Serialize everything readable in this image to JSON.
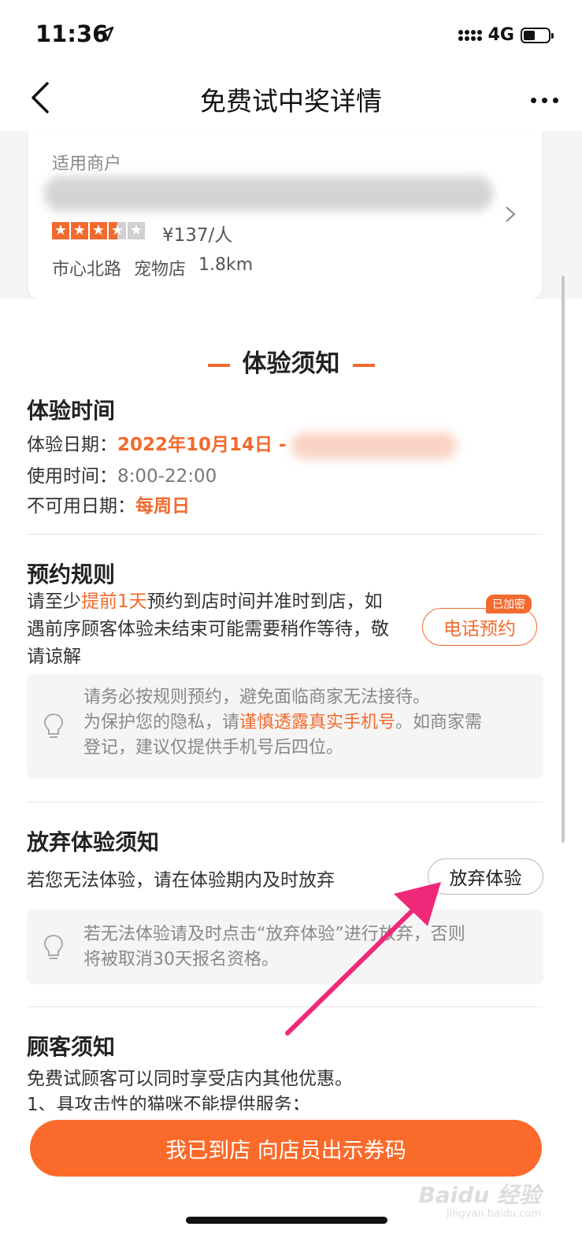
{
  "status": {
    "time": "11:36",
    "network": "4G",
    "battery_level": 0.45
  },
  "nav": {
    "title": "免费试中奖详情"
  },
  "merchant": {
    "label": "适用商户",
    "rating_stars": 3.5,
    "price": "¥137/人",
    "address": "市心北路",
    "category": "宠物店",
    "distance": "1.8km"
  },
  "notice": {
    "heading": "体验须知",
    "time_section": {
      "title": "体验时间",
      "date_label": "体验日期：",
      "date_value": "2022年10月14日 -",
      "use_time_label": "使用时间：",
      "use_time_value": "8:00-22:00",
      "unavailable_label": "不可用日期：",
      "unavailable_value": "每周日"
    },
    "booking": {
      "title": "预约规则",
      "text_prefix": "请至少",
      "text_highlight": "提前1天",
      "text_line1_rest": "预约到店时间并准时到店，如",
      "text_line2": "遇前序顾客体验未结束可能需要稍作等待，敬",
      "text_line3": "请谅解",
      "phone_button": "电话预约",
      "phone_badge": "已加密",
      "tip_line1": "请务必按规则预约，避免面临商家无法接待。",
      "tip_line2_prefix": "为保护您的隐私，请",
      "tip_line2_highlight": "谨慎透露真实手机号",
      "tip_line2_suffix": "。如商家需",
      "tip_line3": "登记，建议仅提供手机号后四位。"
    },
    "abandon": {
      "title": "放弃体验须知",
      "text": "若您无法体验，请在体验期内及时放弃",
      "button": "放弃体验",
      "tip_line1": "若无法体验请及时点击“放弃体验”进行放弃，否则",
      "tip_line2": "将被取消30天报名资格。"
    },
    "customer": {
      "title": "顾客须知",
      "line1": "免费试顾客可以同时享受店内其他优惠。",
      "line2": "1、具攻击性的猫咪不能提供服务；"
    }
  },
  "cta": {
    "label": "我已到店 向店员出示券码"
  },
  "watermark": {
    "brand": "Baidu 经验",
    "sub": "jingyan.baidu.com"
  },
  "colors": {
    "accent": "#f26a2e",
    "cta": "#fa6a2a",
    "annotation_arrow": "#f0287a"
  }
}
